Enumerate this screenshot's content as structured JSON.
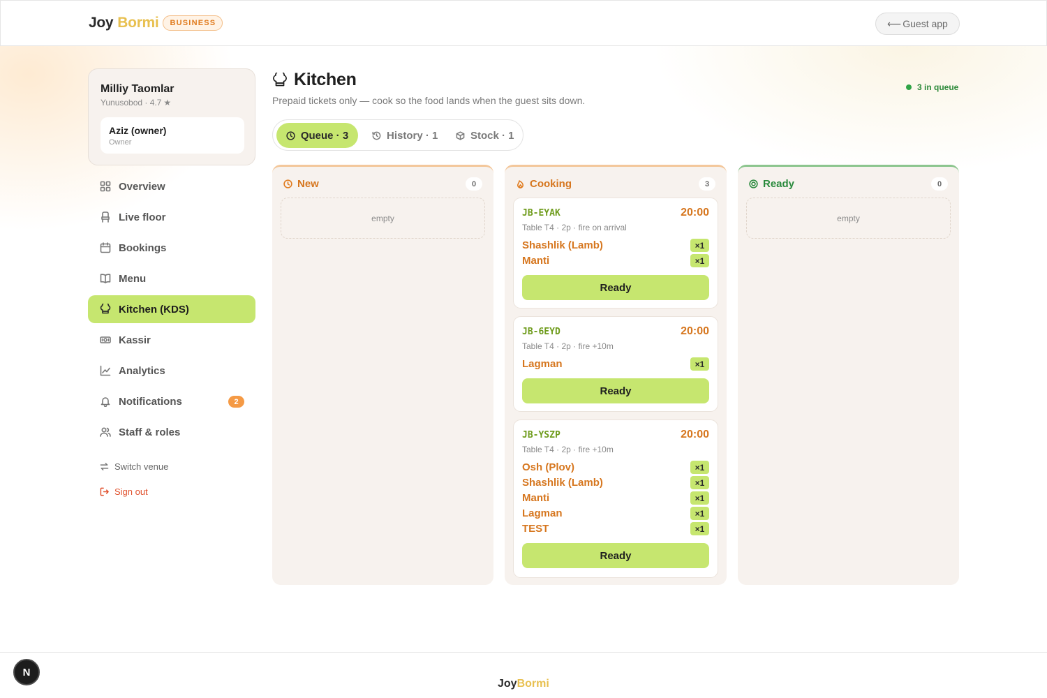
{
  "header": {
    "brand_part1": "Joy",
    "brand_part2": "Bormi",
    "brand_badge": "BUSINESS",
    "guest_app_arrow": "⟵",
    "guest_app_label": "Guest app"
  },
  "sidebar": {
    "venue_name": "Milliy Taomlar",
    "venue_location": "Yunusobod · 4.7",
    "venue_rating_star": "★",
    "user_name": "Aziz (owner)",
    "user_role": "Owner",
    "items": [
      {
        "label": "Overview",
        "icon": "grid-icon"
      },
      {
        "label": "Live floor",
        "icon": "chair-icon"
      },
      {
        "label": "Bookings",
        "icon": "calendar-icon"
      },
      {
        "label": "Menu",
        "icon": "book-icon"
      },
      {
        "label": "Kitchen (KDS)",
        "icon": "chef-hat-icon",
        "active": true
      },
      {
        "label": "Kassir",
        "icon": "cash-icon"
      },
      {
        "label": "Analytics",
        "icon": "chart-icon"
      },
      {
        "label": "Notifications",
        "icon": "bell-icon",
        "badge": "2"
      },
      {
        "label": "Staff & roles",
        "icon": "users-icon"
      }
    ],
    "switch_venue": "Switch venue",
    "sign_out": "Sign out"
  },
  "main": {
    "title": "Kitchen",
    "subtitle": "Prepaid tickets only — cook so the food lands when the guest sits down.",
    "queue_status": "3 in queue",
    "tabs": [
      {
        "label": "Queue · 3",
        "icon": "clock-icon",
        "active": true
      },
      {
        "label": "History · 1",
        "icon": "history-icon"
      },
      {
        "label": "Stock · 1",
        "icon": "box-icon"
      }
    ],
    "columns": [
      {
        "title": "New",
        "count": "0",
        "empty_text": "empty"
      },
      {
        "title": "Cooking",
        "count": "3"
      },
      {
        "title": "Ready",
        "count": "0",
        "empty_text": "empty"
      }
    ],
    "tickets": [
      {
        "code": "JB-EYAK",
        "time": "20:00",
        "meta": "Table T4 · 2p · fire on arrival",
        "items": [
          {
            "name": "Shashlik (Lamb)",
            "qty": "×1"
          },
          {
            "name": "Manti",
            "qty": "×1"
          }
        ],
        "action": "Ready"
      },
      {
        "code": "JB-6EYD",
        "time": "20:00",
        "meta": "Table T4 · 2p · fire +10m",
        "items": [
          {
            "name": "Lagman",
            "qty": "×1"
          }
        ],
        "action": "Ready"
      },
      {
        "code": "JB-YSZP",
        "time": "20:00",
        "meta": "Table T4 · 2p · fire +10m",
        "items": [
          {
            "name": "Osh (Plov)",
            "qty": "×1"
          },
          {
            "name": "Shashlik (Lamb)",
            "qty": "×1"
          },
          {
            "name": "Manti",
            "qty": "×1"
          },
          {
            "name": "Lagman",
            "qty": "×1"
          },
          {
            "name": "TEST",
            "qty": "×1"
          }
        ],
        "action": "Ready"
      }
    ]
  },
  "footer": {
    "brand_part1": "Joy",
    "brand_part2": "Bormi",
    "dev_badge": "N"
  },
  "colors": {
    "accent_lime": "#c6e66f",
    "accent_orange": "#d6761e",
    "ready_green": "#2a8a3d",
    "brand_yellow": "#e8c050",
    "danger": "#e0502c"
  }
}
